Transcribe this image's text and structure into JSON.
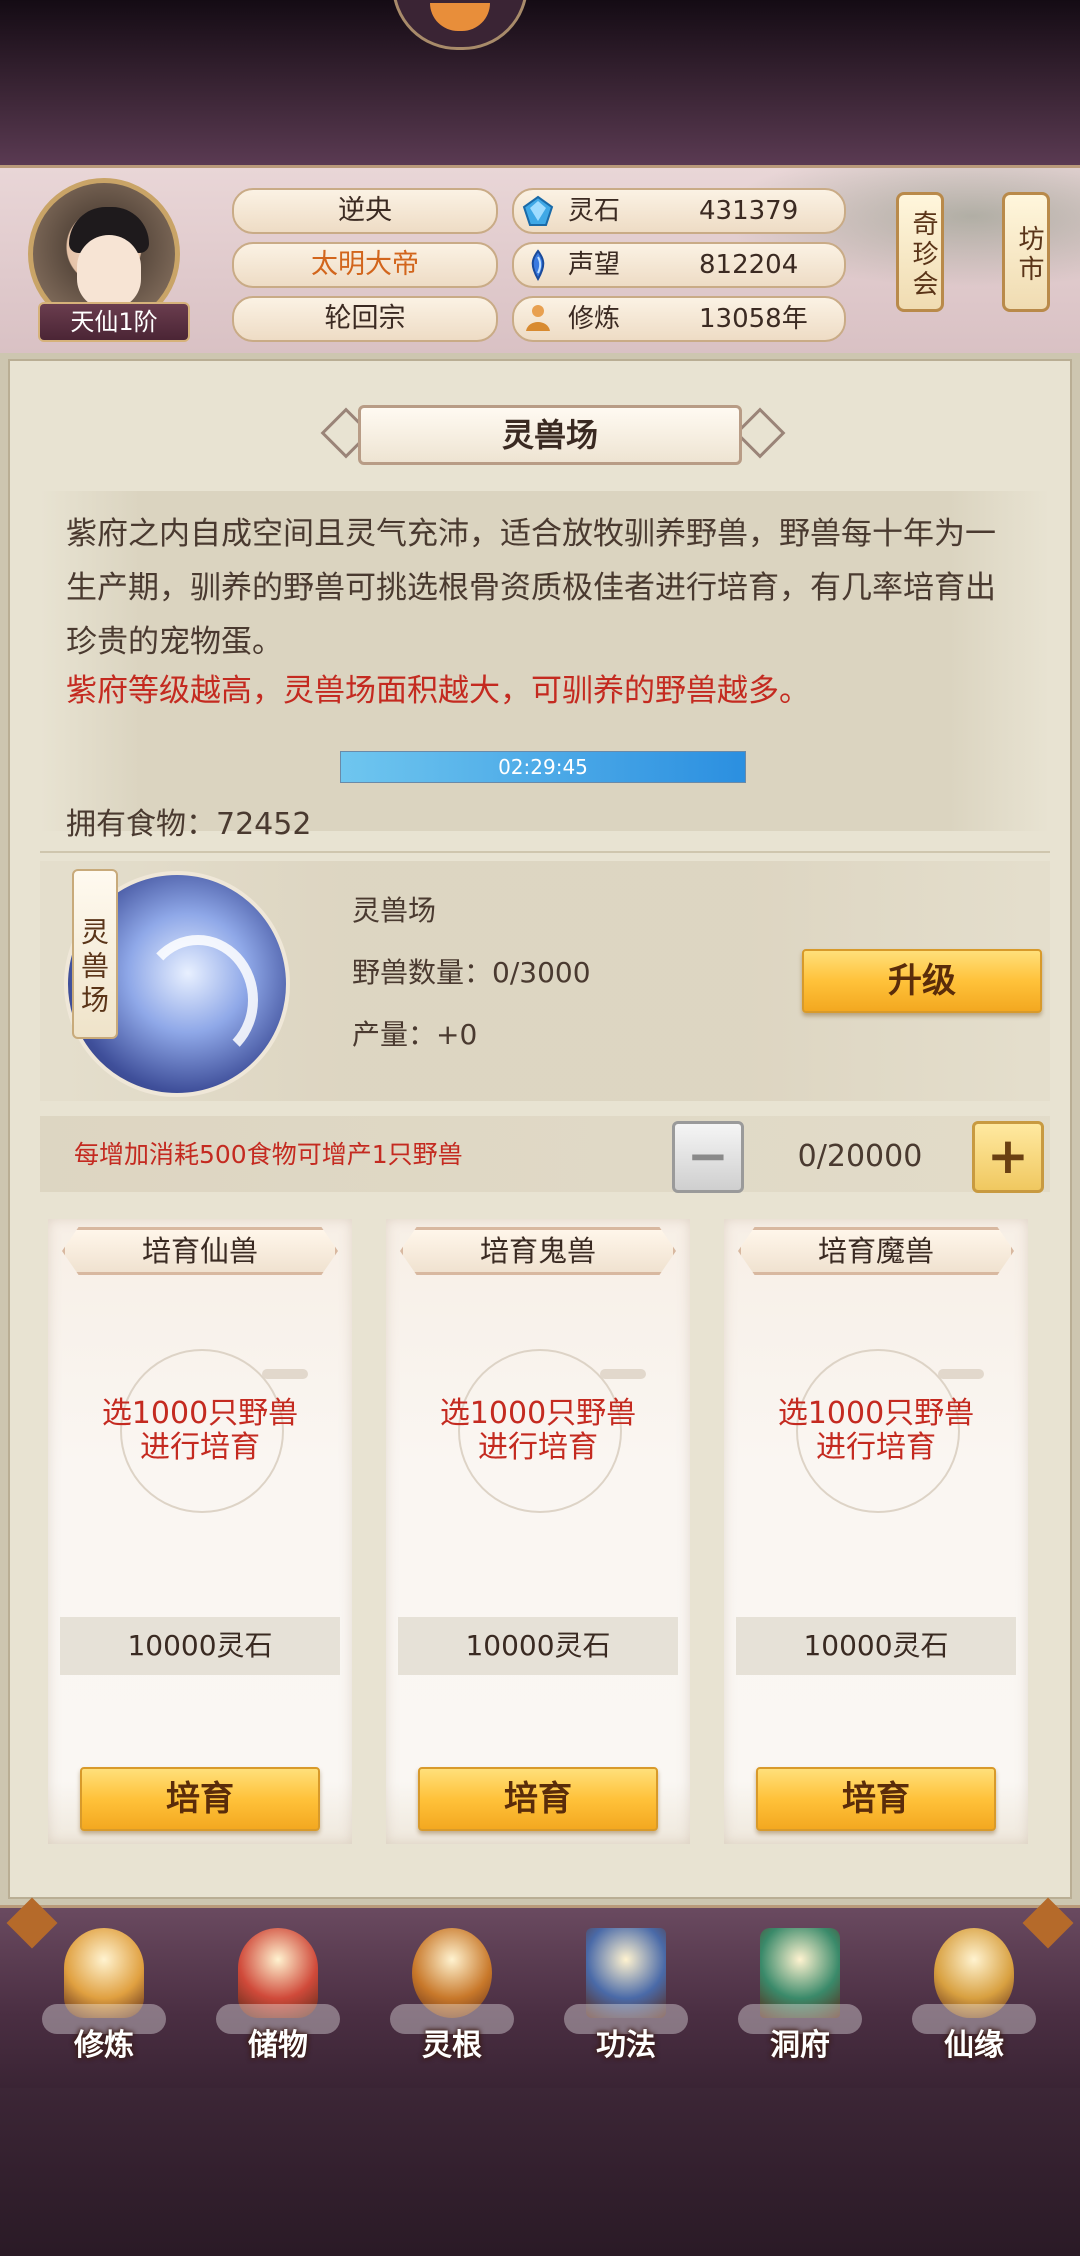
{
  "header": {
    "rank_badge": "天仙1阶",
    "player_name": "逆央",
    "title": "太明大帝",
    "sect": "轮回宗",
    "resources": [
      {
        "icon": "spirit-stone-icon",
        "label": "灵石",
        "value": "431379"
      },
      {
        "icon": "reputation-icon",
        "label": "声望",
        "value": "812204"
      },
      {
        "icon": "cultivation-icon",
        "label": "修炼",
        "value": "13058年"
      }
    ],
    "buttons": {
      "treasure": "奇珍会",
      "market": "坊市"
    }
  },
  "panel": {
    "title": "灵兽场",
    "description": "紫府之内自成空间且灵气充沛，适合放牧驯养野兽，野兽每十年为一生产期，驯养的野兽可挑选根骨资质极佳者进行培育，有几率培育出珍贵的宠物蛋。",
    "note": "紫府等级越高，灵兽场面积越大，可驯养的野兽越多。",
    "timer": "02:29:45",
    "timer_progress": 1.0,
    "food": "拥有食物：72452"
  },
  "beast": {
    "scroll_label": "灵兽场",
    "name": "灵兽场",
    "count": "野兽数量：0/3000",
    "output": "产量：+0",
    "upgrade_label": "升级"
  },
  "consume": {
    "text": "每增加消耗500食物可增产1只野兽",
    "value": "0/20000"
  },
  "cards": [
    {
      "title": "培育仙兽",
      "select_line1": "选1000只野兽",
      "select_line2": "进行培育",
      "cost": "10000灵石",
      "button": "培育"
    },
    {
      "title": "培育鬼兽",
      "select_line1": "选1000只野兽",
      "select_line2": "进行培育",
      "cost": "10000灵石",
      "button": "培育"
    },
    {
      "title": "培育魔兽",
      "select_line1": "选1000只野兽",
      "select_line2": "进行培育",
      "cost": "10000灵石",
      "button": "培育"
    }
  ],
  "nav": [
    {
      "label": "修炼",
      "icon": "meditating-monk-icon",
      "color": "#e0a040"
    },
    {
      "label": "储物",
      "icon": "storage-bag-icon",
      "color": "#d04a3a"
    },
    {
      "label": "灵根",
      "icon": "spirit-root-icon",
      "color": "#c8782a"
    },
    {
      "label": "功法",
      "icon": "technique-book-icon",
      "color": "#4a6aa8"
    },
    {
      "label": "洞府",
      "icon": "cave-residence-icon",
      "color": "#3a8a6a"
    },
    {
      "label": "仙缘",
      "icon": "gourd-icon",
      "color": "#d8a040"
    }
  ]
}
